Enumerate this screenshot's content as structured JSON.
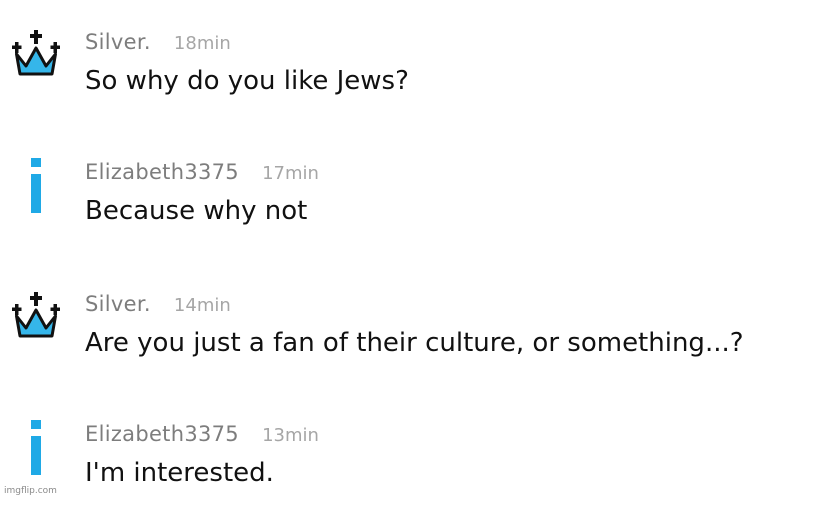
{
  "colors": {
    "username": "#7d7d7d",
    "timestamp": "#a6a6a6",
    "message_text": "#111111",
    "crown_fill": "#35b6ea",
    "info_icon": "#1fa9e6"
  },
  "messages": [
    {
      "username": "Silver.",
      "time": "18min",
      "text": "So why do you like Jews?",
      "avatar_icon": "crown-icon"
    },
    {
      "username": "Elizabeth3375",
      "time": "17min",
      "text": "Because why not",
      "avatar_icon": "info-icon"
    },
    {
      "username": "Silver.",
      "time": "14min",
      "text": "Are you just a fan of their culture, or something...?",
      "avatar_icon": "crown-icon"
    },
    {
      "username": "Elizabeth3375",
      "time": "13min",
      "text": "I'm interested.",
      "avatar_icon": "info-icon"
    }
  ],
  "watermark": "imgflip.com"
}
